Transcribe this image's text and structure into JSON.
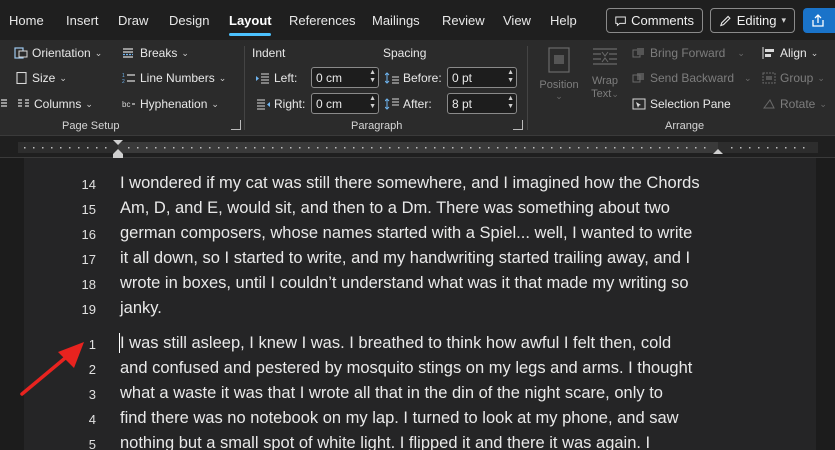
{
  "menubar": {
    "tabs": [
      "Home",
      "Insert",
      "Draw",
      "Design",
      "Layout",
      "References",
      "Mailings",
      "Review",
      "View",
      "Help"
    ],
    "active_tab": "Layout",
    "comments_label": "Comments",
    "editing_label": "Editing"
  },
  "ribbon": {
    "page_setup": {
      "orientation": "Orientation",
      "size": "Size",
      "columns": "Columns",
      "breaks": "Breaks",
      "line_numbers": "Line Numbers",
      "hyphenation": "Hyphenation",
      "group_label": "Page Setup"
    },
    "paragraph": {
      "indent_label": "Indent",
      "spacing_label": "Spacing",
      "left_label": "Left:",
      "left_value": "0 cm",
      "right_label": "Right:",
      "right_value": "0 cm",
      "before_label": "Before:",
      "before_value": "0 pt",
      "after_label": "After:",
      "after_value": "8 pt",
      "group_label": "Paragraph"
    },
    "arrange": {
      "position": "Position",
      "wrap_text_1": "Wrap",
      "wrap_text_2": "Text",
      "bring_forward": "Bring Forward",
      "send_backward": "Send Backward",
      "selection_pane": "Selection Pane",
      "align": "Align",
      "group": "Group",
      "rotate": "Rotate",
      "group_label": "Arrange"
    }
  },
  "document": {
    "para1": [
      {
        "num": "14",
        "text": "I wondered if my cat was still there somewhere, and I imagined how the Chords"
      },
      {
        "num": "15",
        "text": "Am, D, and E, would sit, and then to a Dm. There was something about two"
      },
      {
        "num": "16",
        "text": "german composers, whose names started with a Spiel... well, I wanted to write"
      },
      {
        "num": "17",
        "text": "it all down, so I started to write, and my handwriting started trailing away, and I"
      },
      {
        "num": "18",
        "text": "wrote in boxes, until I couldn’t understand what was it that made my writing so"
      },
      {
        "num": "19",
        "text": "janky."
      }
    ],
    "para2": [
      {
        "num": "1",
        "text": "I was still asleep, I knew I was. I breathed to think how awful I felt then, cold"
      },
      {
        "num": "2",
        "text": "and confused and pestered by mosquito stings on my legs and arms. I thought"
      },
      {
        "num": "3",
        "text": "what a waste it was that I wrote all that in the din of the night scare, only to"
      },
      {
        "num": "4",
        "text": "find there was no notebook on my lap. I turned to look at my phone, and saw"
      },
      {
        "num": "5",
        "text": "nothing but a small spot of white light. I flipped it and there it was again. I"
      }
    ]
  },
  "colors": {
    "accent": "#4cc2ff",
    "share_button": "#1a73c9",
    "annotation_arrow": "#e8231f"
  }
}
